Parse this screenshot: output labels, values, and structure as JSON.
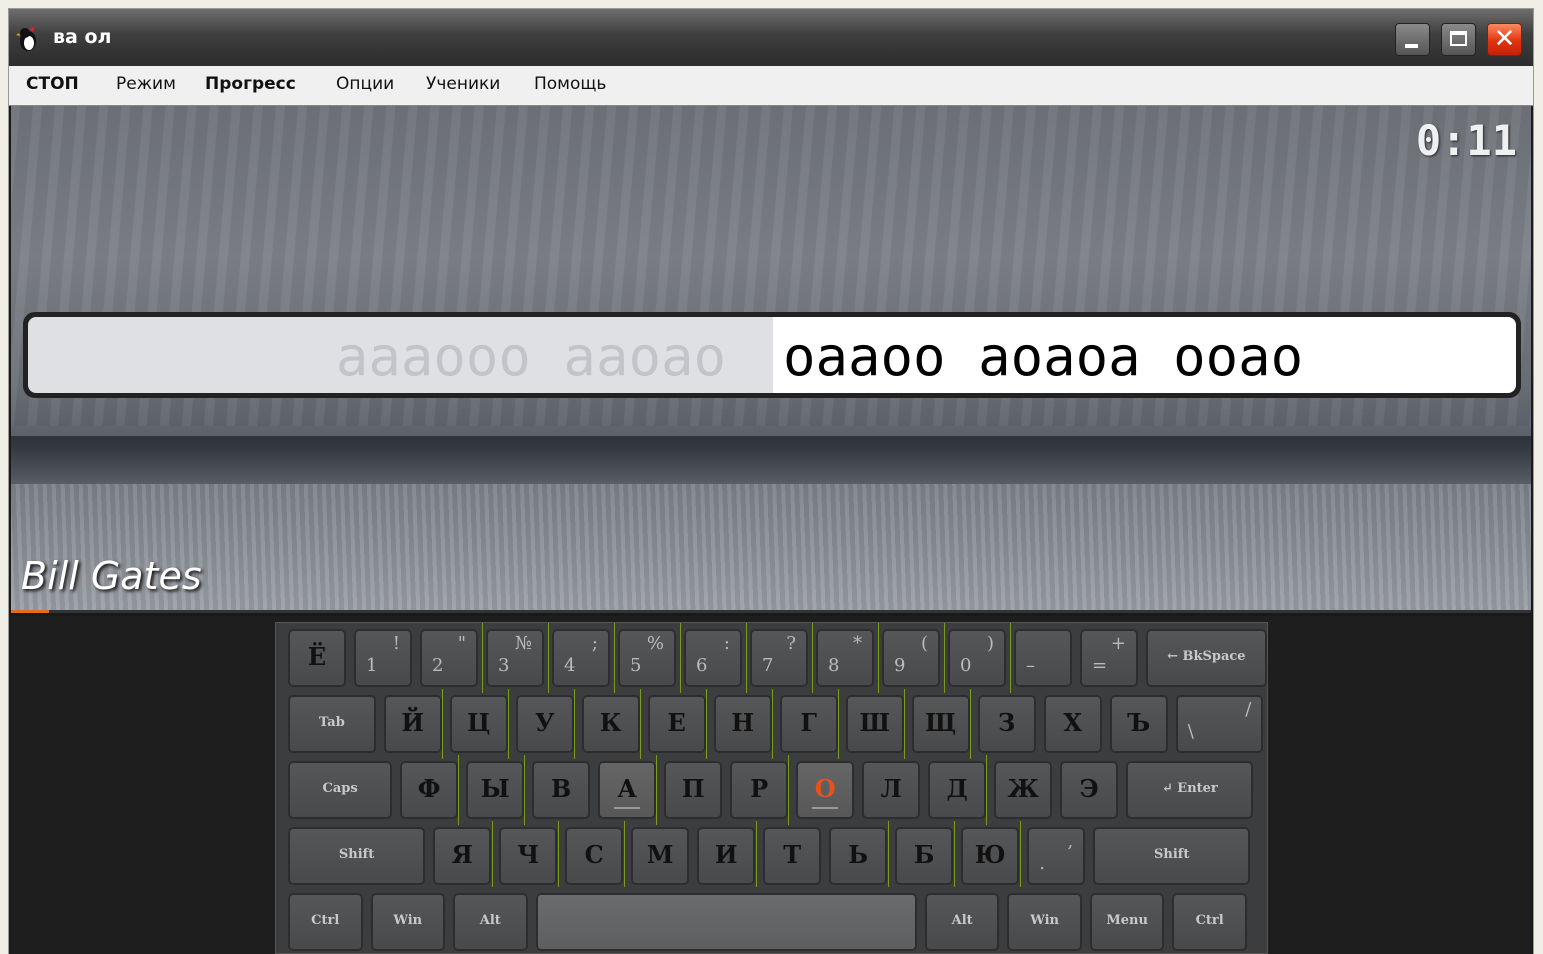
{
  "window": {
    "title": "ва  ол",
    "buttons": {
      "minimize": "minimize",
      "maximize": "maximize",
      "close": "✕"
    }
  },
  "menu": [
    {
      "label": "СТОП",
      "bold": true
    },
    {
      "label": "Режим",
      "bold": false
    },
    {
      "label": "Прогресс",
      "bold": true
    },
    {
      "label": "Опции",
      "bold": false
    },
    {
      "label": "Ученики",
      "bold": false
    },
    {
      "label": "Помощь",
      "bold": false
    }
  ],
  "exercise": {
    "timer": "0:11",
    "typed": "aaaooo aaoao",
    "pending": "oaaoo aoaoa ooao",
    "author": "Bill Gates",
    "progress": 0.025
  },
  "keyboard": {
    "highlight_colors": {
      "target_key": "#e6521e",
      "finger_zones": "#7a9a1a"
    },
    "rows": [
      [
        {
          "main": "Ё"
        },
        {
          "top": "!",
          "bot": "1"
        },
        {
          "top": "\"",
          "bot": "2"
        },
        {
          "top": "№",
          "bot": "3"
        },
        {
          "top": ";",
          "bot": "4"
        },
        {
          "top": "%",
          "bot": "5"
        },
        {
          "top": ":",
          "bot": "6"
        },
        {
          "top": "?",
          "bot": "7"
        },
        {
          "top": "*",
          "bot": "8"
        },
        {
          "top": "(",
          "bot": "9"
        },
        {
          "top": ")",
          "bot": "0"
        },
        {
          "top": "",
          "bot": "–"
        },
        {
          "top": "+",
          "bot": "="
        },
        {
          "small": "← BkSpace"
        }
      ],
      [
        {
          "small": "Tab"
        },
        {
          "main": "Й"
        },
        {
          "main": "Ц"
        },
        {
          "main": "У"
        },
        {
          "main": "К"
        },
        {
          "main": "Е"
        },
        {
          "main": "Н"
        },
        {
          "main": "Г"
        },
        {
          "main": "Ш"
        },
        {
          "main": "Щ"
        },
        {
          "main": "З"
        },
        {
          "main": "Х"
        },
        {
          "main": "Ъ"
        },
        {
          "top": "/",
          "bot": "\\"
        }
      ],
      [
        {
          "small": "Caps"
        },
        {
          "main": "Ф"
        },
        {
          "main": "Ы"
        },
        {
          "main": "В"
        },
        {
          "main": "А"
        },
        {
          "main": "П"
        },
        {
          "main": "Р"
        },
        {
          "main": "О"
        },
        {
          "main": "Л"
        },
        {
          "main": "Д"
        },
        {
          "main": "Ж"
        },
        {
          "main": "Э"
        },
        {
          "small": "↵ Enter"
        }
      ],
      [
        {
          "small": "Shift"
        },
        {
          "main": "Я"
        },
        {
          "main": "Ч"
        },
        {
          "main": "С"
        },
        {
          "main": "М"
        },
        {
          "main": "И"
        },
        {
          "main": "Т"
        },
        {
          "main": "Ь"
        },
        {
          "main": "Б"
        },
        {
          "main": "Ю"
        },
        {
          "top": ",",
          "bot": "."
        },
        {
          "small": "Shift"
        }
      ],
      [
        {
          "small": "Ctrl"
        },
        {
          "small": "Win"
        },
        {
          "small": "Alt"
        },
        {
          "small": ""
        },
        {
          "small": "Alt"
        },
        {
          "small": "Win"
        },
        {
          "small": "Menu"
        },
        {
          "small": "Ctrl"
        }
      ]
    ]
  }
}
